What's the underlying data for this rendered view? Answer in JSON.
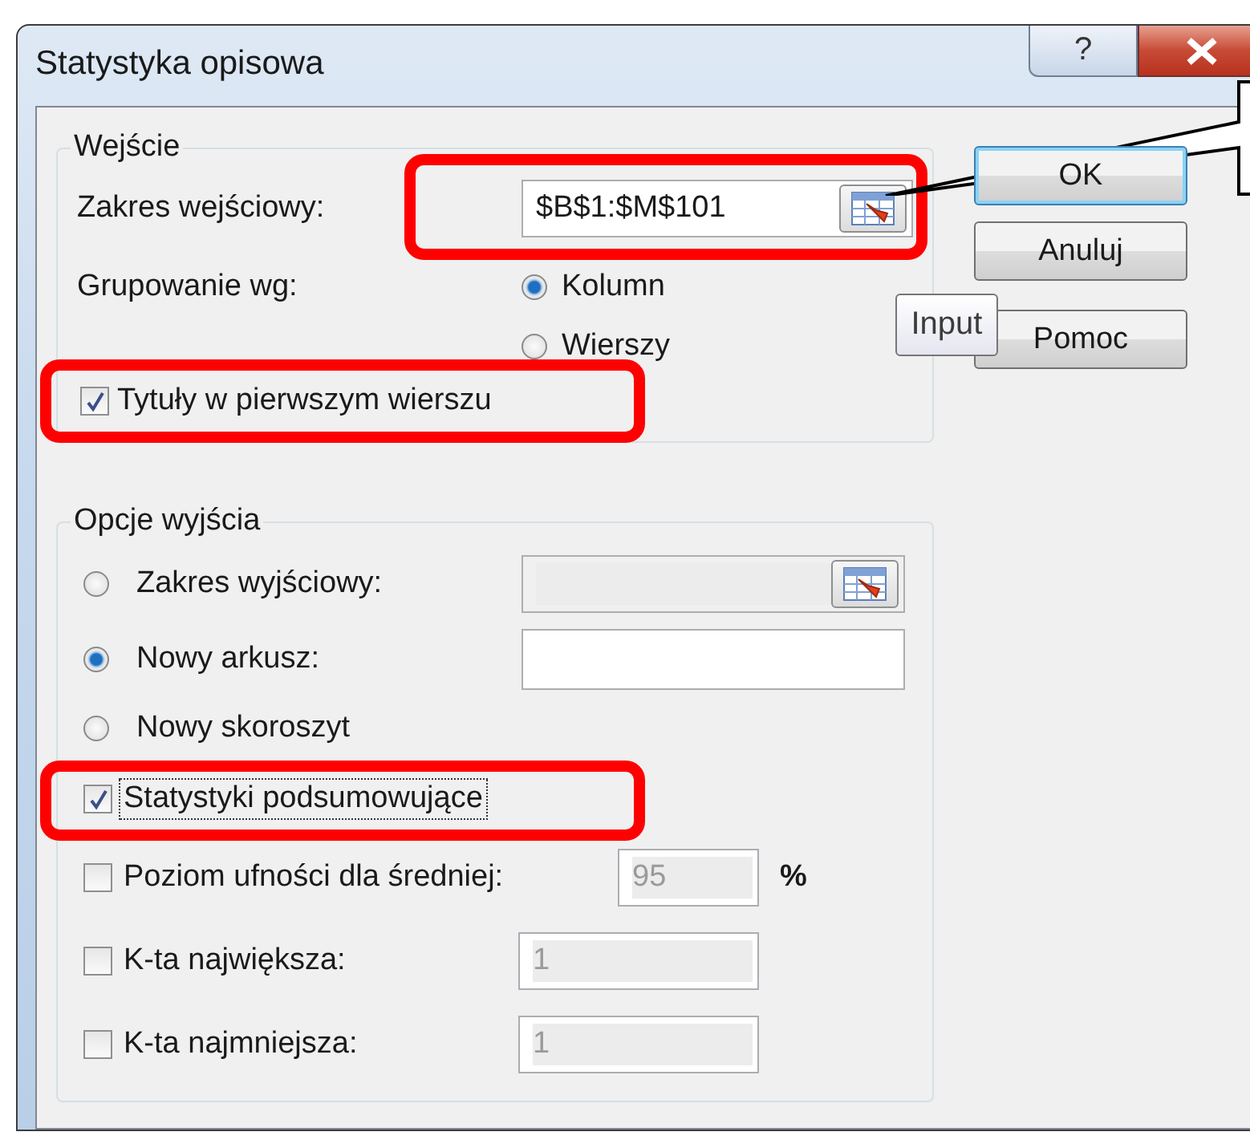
{
  "window": {
    "title": "Statystyka opisowa",
    "help_button": "?"
  },
  "input_group": {
    "legend": "Wejście",
    "range_label": "Zakres wejściowy:",
    "range_value": "$B$1:$M$101",
    "range_highlighted": true,
    "grouping_label": "Grupowanie wg:",
    "grouping_options": [
      {
        "label": "Kolumn",
        "selected": true
      },
      {
        "label": "Wierszy",
        "selected": false
      }
    ],
    "labels_checkbox": {
      "label": "Tytuły w pierwszym wierszu",
      "checked": true,
      "highlighted": true
    }
  },
  "output_group": {
    "legend": "Opcje wyjścia",
    "destinations": [
      {
        "kind": "range",
        "label": "Zakres wyjściowy:",
        "selected": false
      },
      {
        "kind": "text",
        "label": "Nowy arkusz:",
        "selected": true
      },
      {
        "kind": "none",
        "label": "Nowy skoroszyt",
        "selected": false
      }
    ],
    "options": [
      {
        "label": "Statystyki podsumowujące",
        "checked": true,
        "focused": true,
        "highlighted": true
      },
      {
        "label": "Poziom ufności dla średniej:",
        "checked": false,
        "focused": false,
        "value": "95",
        "unit": "%"
      },
      {
        "label": "K-ta największa:",
        "checked": false,
        "focused": false,
        "value": "1"
      },
      {
        "label": "K-ta najmniejsza:",
        "checked": false,
        "focused": false,
        "value": "1"
      }
    ]
  },
  "buttons": [
    {
      "label": "OK",
      "default": true
    },
    {
      "label": "Anuluj",
      "default": false
    },
    {
      "label": "Pomoc",
      "default": false
    }
  ],
  "tooltip": "Input"
}
